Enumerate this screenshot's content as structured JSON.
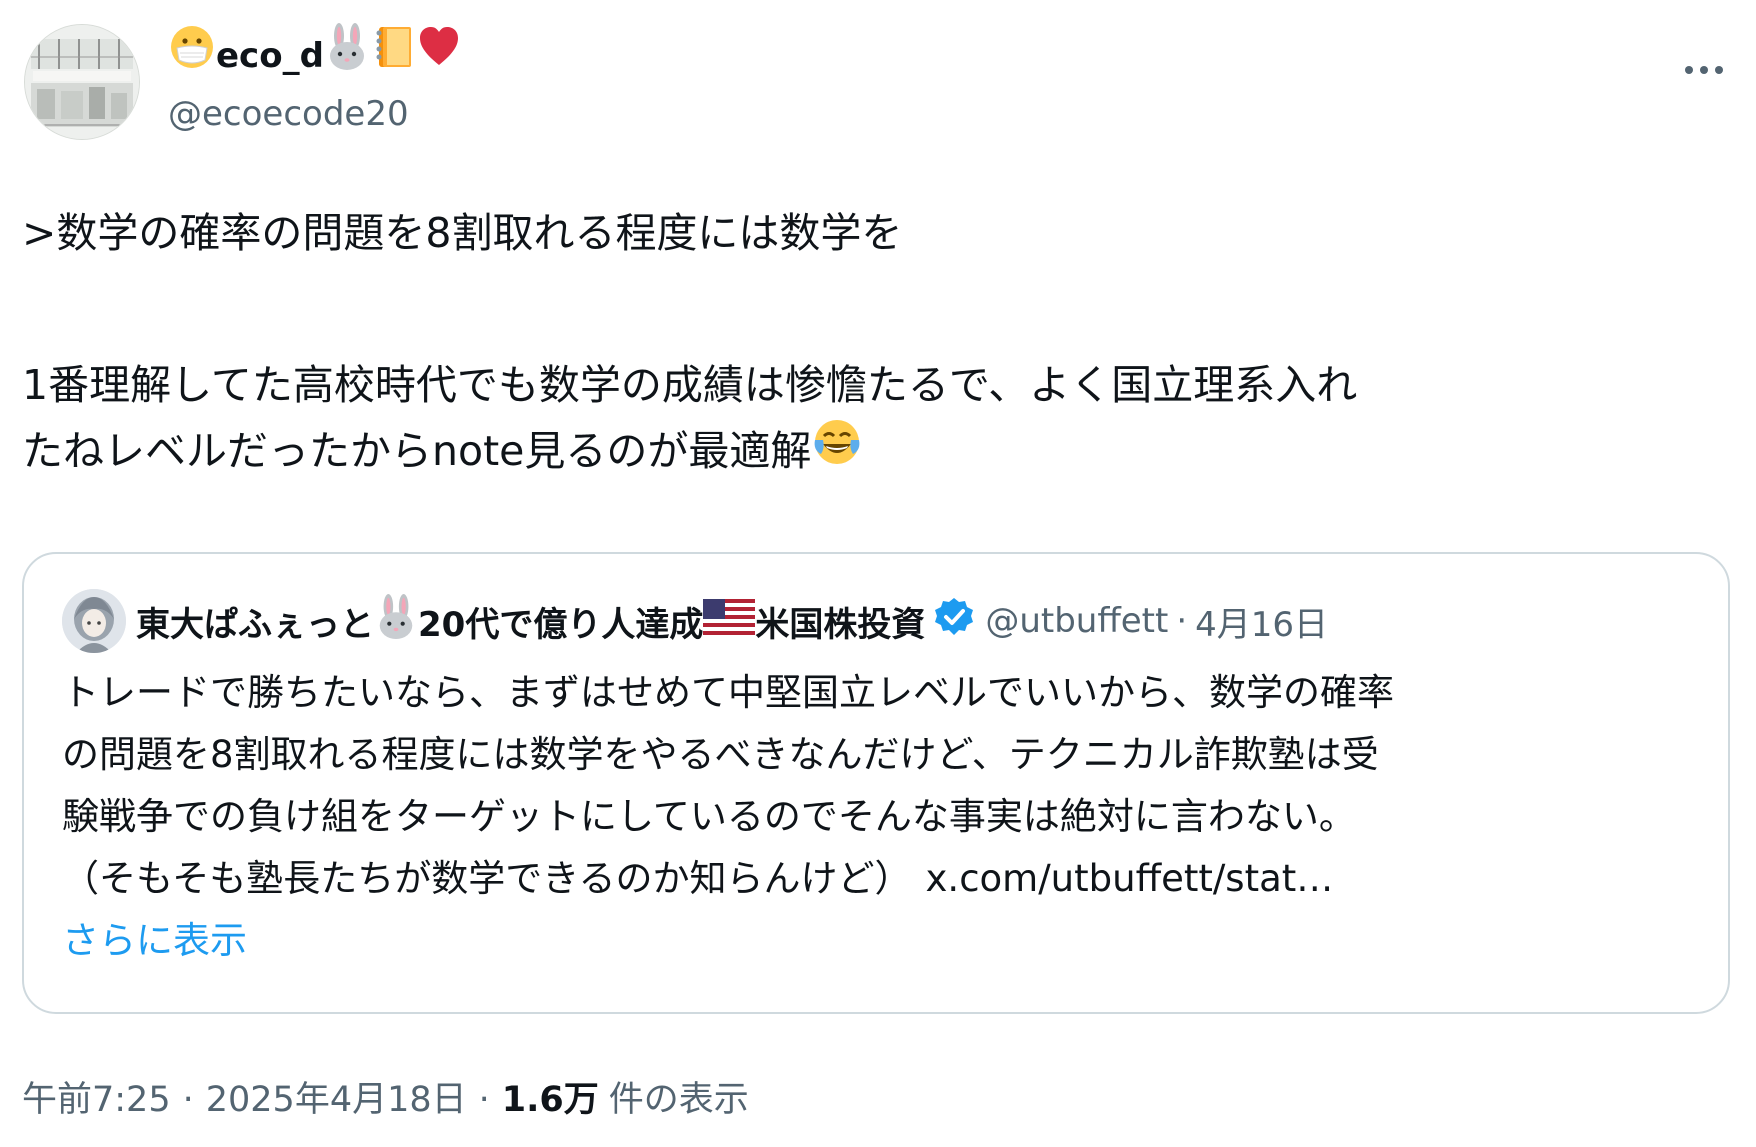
{
  "author": {
    "display_name": "eco_d",
    "handle": "@ecoecode20",
    "avatar_caption": "実際に存在する生体の壁"
  },
  "tweet": {
    "line1": ">数学の確率の問題を8割取れる程度には数学を",
    "line2": "1番理解してた高校時代でも数学の成績は惨憺たるで、よく国立理系入れ",
    "line3": "たねレベルだったからnote見るのが最適解"
  },
  "quote": {
    "display_name": "東大ぱふぇっと",
    "display_name_mid": "20代で億り人達成",
    "display_name_end": "米国株投資",
    "handle": "@utbuffett",
    "dot": "·",
    "date": "4月16日",
    "line1": "トレードで勝ちたいなら、まずはせめて中堅国立レベルでいいから、数学の確率",
    "line2": "の問題を8割取れる程度には数学をやるべきなんだけど、テクニカル詐欺塾は受",
    "line3": "験戦争での負け組をターゲットにしているのでそんな事実は絶対に言わない。",
    "line4": "（そもそも塾長たちが数学できるのか知らんけど）",
    "link": "x.com/utbuffett/stat…",
    "show_more": "さらに表示"
  },
  "meta": {
    "time": "午前7:25",
    "sep1": "·",
    "date": "2025年4月18日",
    "sep2": "·",
    "views_count": "1.6万",
    "views_label": "件の表示"
  },
  "colors": {
    "text": "#0f1419",
    "secondary": "#536471",
    "link": "#1d9bf0",
    "border": "#cfd9de",
    "verified": "#1d9bf0"
  },
  "icons": {
    "mask_emoji": "face-with-medical-mask-icon",
    "rabbit_emoji": "rabbit-face-icon",
    "notebook_emoji": "notebook-icon",
    "heart_emoji": "red-heart-icon",
    "laugh_emoji": "face-with-tears-of-joy-icon",
    "flag_emoji": "us-flag-icon",
    "verified": "verified-badge-icon",
    "more": "more-horizontal-icon"
  }
}
